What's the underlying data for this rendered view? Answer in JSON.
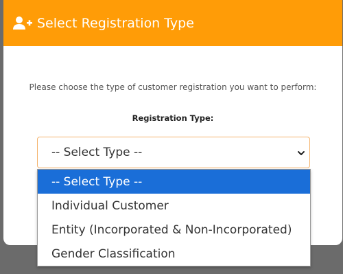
{
  "colors": {
    "header_background": "#ff9c07",
    "selected_option_background": "#1a6ed8",
    "select_border": "#f4b26b"
  },
  "modal": {
    "header": {
      "icon": "user-plus-icon",
      "title": "Select Registration Type"
    },
    "prompt": "Please choose the type of customer registration you want to perform:",
    "field_label": "Registration Type:",
    "select": {
      "value": "-- Select Type --",
      "icon": "chevron-down-icon"
    },
    "dropdown": {
      "options": [
        {
          "label": "-- Select Type --",
          "selected": true
        },
        {
          "label": "Individual Customer",
          "selected": false
        },
        {
          "label": "Entity (Incorporated & Non-Incorporated)",
          "selected": false
        },
        {
          "label": "Gender Classification",
          "selected": false
        }
      ]
    }
  }
}
